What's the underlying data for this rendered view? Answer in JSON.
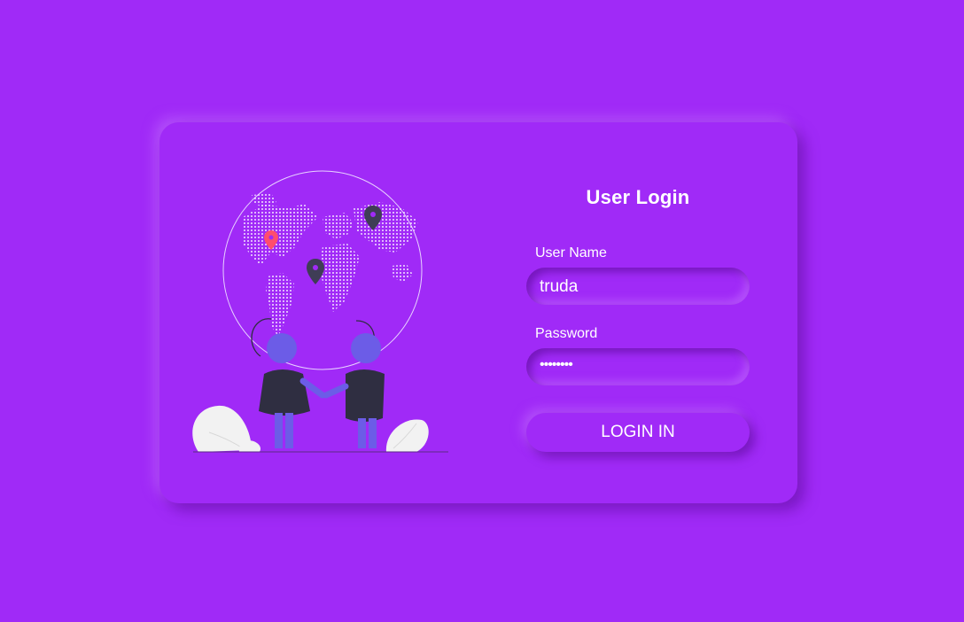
{
  "form": {
    "title": "User Login",
    "username_label": "User Name",
    "username_value": "truda",
    "password_label": "Password",
    "password_value": "••••••••",
    "login_label": "LOGIN IN"
  },
  "colors": {
    "background": "#a02af7",
    "text": "#ffffff",
    "person_skin": "#6c5ce7",
    "person_shirt": "#2f2e41",
    "pin_red": "#ff4d6d",
    "pin_dark": "#3f3d56",
    "leaf": "#f2f2f2"
  },
  "illustration": {
    "icons": [
      "globe-icon",
      "map-pin-icon",
      "people-handshake-icon",
      "leaf-icon"
    ]
  }
}
